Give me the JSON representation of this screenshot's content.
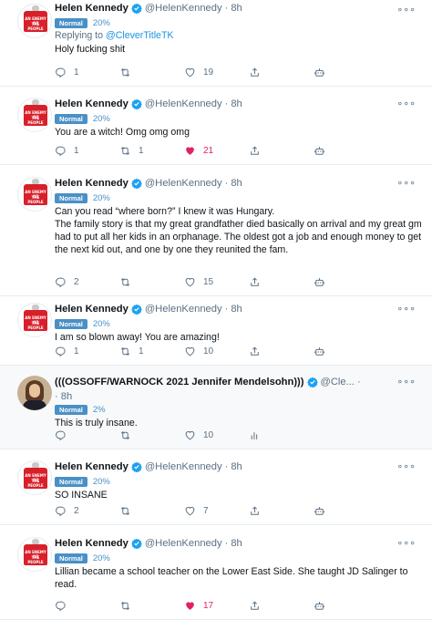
{
  "colors": {
    "accent": "#1b95e0",
    "liked": "#e0245e",
    "badge": "#4a90c6",
    "muted": "#5b7083"
  },
  "tweets": [
    {
      "name": "Helen Kennedy",
      "handle": "@HelenKennedy",
      "time": "8h",
      "badge": "Normal",
      "pct": "20%",
      "reply_prefix": "Replying to ",
      "reply_to": "@CleverTitleTK",
      "text": [
        "Holy fucking shit"
      ],
      "replies": "1",
      "retweets": "",
      "likes": "19",
      "liked": false
    },
    {
      "name": "Helen Kennedy",
      "handle": "@HelenKennedy",
      "time": "8h",
      "badge": "Normal",
      "pct": "20%",
      "text": [
        "You are a witch! Omg omg omg"
      ],
      "replies": "1",
      "retweets": "1",
      "likes": "21",
      "liked": true
    },
    {
      "name": "Helen Kennedy",
      "handle": "@HelenKennedy",
      "time": "8h",
      "badge": "Normal",
      "pct": "20%",
      "text": [
        "Can you read “where born?” I knew it was Hungary.",
        "The family story is that my great grandfather died basically on arrival and my great gm had to put all her kids in an orphanage. The oldest got a job and enough money to get the next kid out, and one by one they reunited the fam."
      ],
      "replies": "2",
      "retweets": "",
      "likes": "15",
      "liked": false
    },
    {
      "name": "Helen Kennedy",
      "handle": "@HelenKennedy",
      "time": "8h",
      "badge": "Normal",
      "pct": "20%",
      "text": [
        "I am so blown away! You are amazing!"
      ],
      "replies": "1",
      "retweets": "1",
      "likes": "10",
      "liked": false
    },
    {
      "name": "(((OSSOFF/WARNOCK 2021 Jennifer Mendelsohn)))",
      "handle": "@Cle...",
      "time": "8h",
      "badge": "Normal",
      "pct": "2%",
      "text": [
        "This is truly insane."
      ],
      "replies": "",
      "retweets": "",
      "likes": "10",
      "liked": false
    },
    {
      "name": "Helen Kennedy",
      "handle": "@HelenKennedy",
      "time": "8h",
      "badge": "Normal",
      "pct": "20%",
      "text": [
        "SO INSANE"
      ],
      "replies": "2",
      "retweets": "",
      "likes": "7",
      "liked": false
    },
    {
      "name": "Helen Kennedy",
      "handle": "@HelenKennedy",
      "time": "8h",
      "badge": "Normal",
      "pct": "20%",
      "text": [
        "Lillian became a school teacher on the Lower East Side. She taught JD Salinger to read."
      ],
      "replies": "",
      "retweets": "",
      "likes": "17",
      "liked": true
    }
  ],
  "avatar_text": {
    "line1": "AN ENEMY OF",
    "line2": "THE PEOPLE"
  },
  "icons": {
    "more": "more-icon",
    "reply": "reply-icon",
    "retweet": "retweet-icon",
    "like": "heart-icon",
    "share": "share-icon",
    "bot": "bot-detector-icon",
    "analytics": "analytics-icon",
    "verified": "verified-badge-icon"
  }
}
